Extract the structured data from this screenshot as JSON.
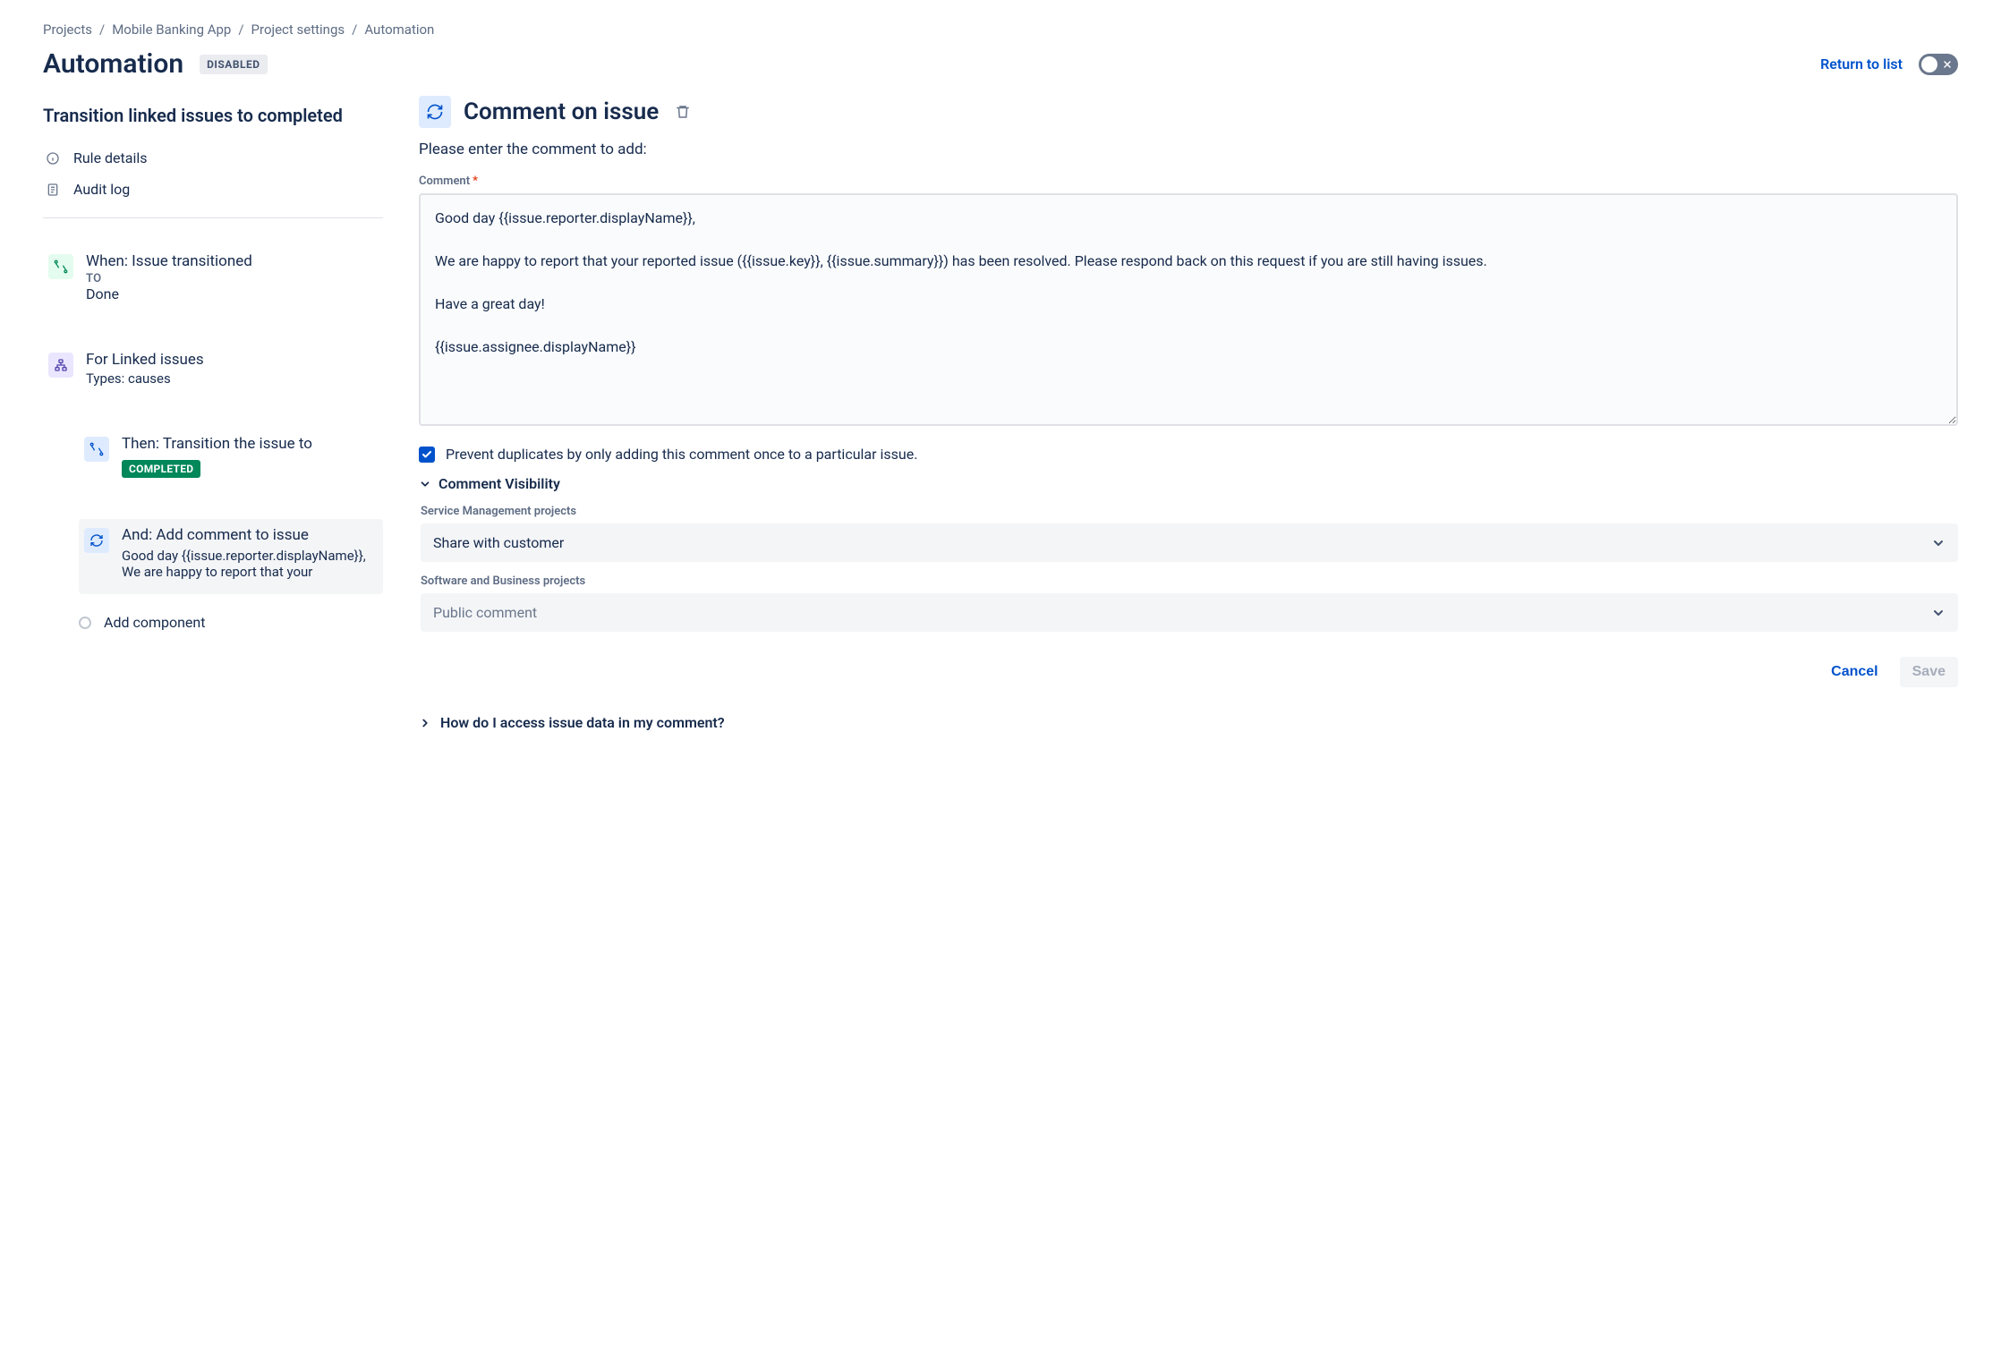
{
  "breadcrumb": [
    "Projects",
    "Mobile Banking App",
    "Project settings",
    "Automation"
  ],
  "header": {
    "title": "Automation",
    "badge": "DISABLED",
    "return": "Return to list"
  },
  "rule": {
    "name": "Transition linked issues to completed",
    "meta": {
      "details": "Rule details",
      "audit": "Audit log"
    },
    "nodes": {
      "trigger": {
        "title": "When: Issue transitioned",
        "sub": "TO",
        "val": "Done"
      },
      "branch": {
        "title": "For Linked issues",
        "val": "Types: causes"
      },
      "thenTransition": {
        "title": "Then: Transition the issue to",
        "chip": "COMPLETED"
      },
      "andComment": {
        "title": "And: Add comment to issue",
        "preview": "Good day {{issue.reporter.displayName}}, We are happy to report that your"
      },
      "addComponent": "Add component"
    }
  },
  "component": {
    "title": "Comment on issue",
    "lead": "Please enter the comment to add:",
    "commentLabel": "Comment",
    "commentValue": "Good day {{issue.reporter.displayName}},\n\nWe are happy to report that your reported issue ({{issue.key}}, {{issue.summary}}) has been resolved. Please respond back on this request if you are still having issues.\n\nHave a great day!\n\n{{issue.assignee.displayName}}",
    "preventDup": "Prevent duplicates by only adding this comment once to a particular issue.",
    "visibility": {
      "header": "Comment Visibility",
      "smLabel": "Service Management projects",
      "smValue": "Share with customer",
      "swLabel": "Software and Business projects",
      "swValue": "Public comment"
    },
    "actions": {
      "cancel": "Cancel",
      "save": "Save"
    },
    "hint": "How do I access issue data in my comment?"
  }
}
